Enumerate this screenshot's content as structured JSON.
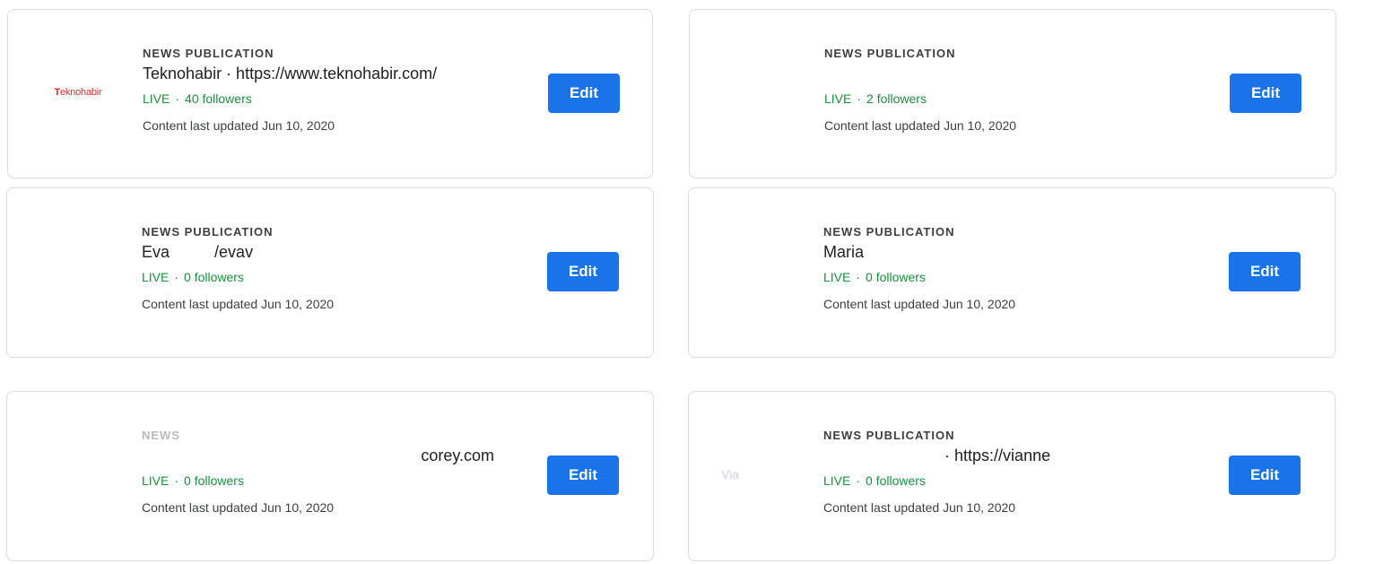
{
  "cards": [
    {
      "overline": "NEWS PUBLICATION",
      "title": "Teknohabir · https://www.teknohabir.com/",
      "logo_text_a": "T",
      "logo_text_b": "eknohabir",
      "live": "LIVE",
      "followers": "40 followers",
      "updated": "Content last updated Jun 10, 2020",
      "edit": "Edit"
    },
    {
      "overline": "NEWS PUBLICATION",
      "title": "",
      "live": "LIVE",
      "followers": "2 followers",
      "updated": "Content last updated Jun 10, 2020",
      "edit": "Edit"
    },
    {
      "overline": "NEWS PUBLICATION",
      "title": "Eva",
      "title_tail": "/evav",
      "live": "LIVE",
      "followers": "0 followers",
      "updated": "Content last updated Jun 10, 2020",
      "edit": "Edit"
    },
    {
      "overline": "NEWS PUBLICATION",
      "title": "Maria",
      "live": "LIVE",
      "followers": "0 followers",
      "updated": "Content last updated Jun 10, 2020",
      "edit": "Edit"
    },
    {
      "overline": "NEWS",
      "title_tail": "corey.com",
      "live": "LIVE",
      "followers": "0 followers",
      "updated": "Content last updated Jun 10, 2020",
      "edit": "Edit"
    },
    {
      "overline": "NEWS PUBLICATION",
      "title_tail": "· https://vianne",
      "logo_faded": "Via",
      "live": "LIVE",
      "followers": "0 followers",
      "updated": "Content last updated Jun 10, 2020",
      "edit": "Edit"
    }
  ],
  "colors": {
    "edit_button": "#1a73e8",
    "live_status": "#1e8e3e",
    "logo_red": "#d32f2f",
    "border": "#dadce0"
  }
}
